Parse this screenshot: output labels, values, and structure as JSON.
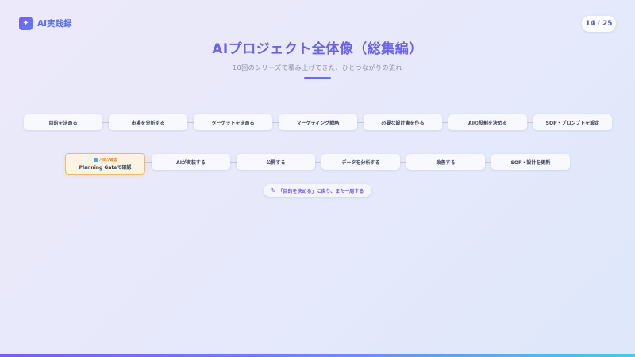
{
  "header": {
    "logo_icon": "sparkle-icon",
    "logo_text": "AI実践録",
    "page_current": "14",
    "page_sep": "/",
    "page_total": "25"
  },
  "title": "AIプロジェクト全体像（総集編）",
  "subtitle": "10回のシリーズで積み上げてきた、ひとつながりの流れ",
  "flow": {
    "row1": [
      "目的を決める",
      "市場を分析する",
      "ターゲットを決める",
      "マーケティング戦略",
      "必要な設計書を作る",
      "AIの役割を決める",
      "SOP・プロンプトを設定"
    ],
    "checkpoint": {
      "badge": "人間が確認",
      "label": "Planning Gateで確認"
    },
    "row2": [
      "AIが実装する",
      "公開する",
      "データを分析する",
      "改善する",
      "SOP・設計を更新"
    ],
    "loop_icon": "↻",
    "loop_text": "「目的を決める」に戻り、また一周する"
  },
  "colors": {
    "accent": "#6a62e8",
    "checkpoint_border": "#f1b968",
    "checkpoint_bg": "#fdf3e3"
  }
}
